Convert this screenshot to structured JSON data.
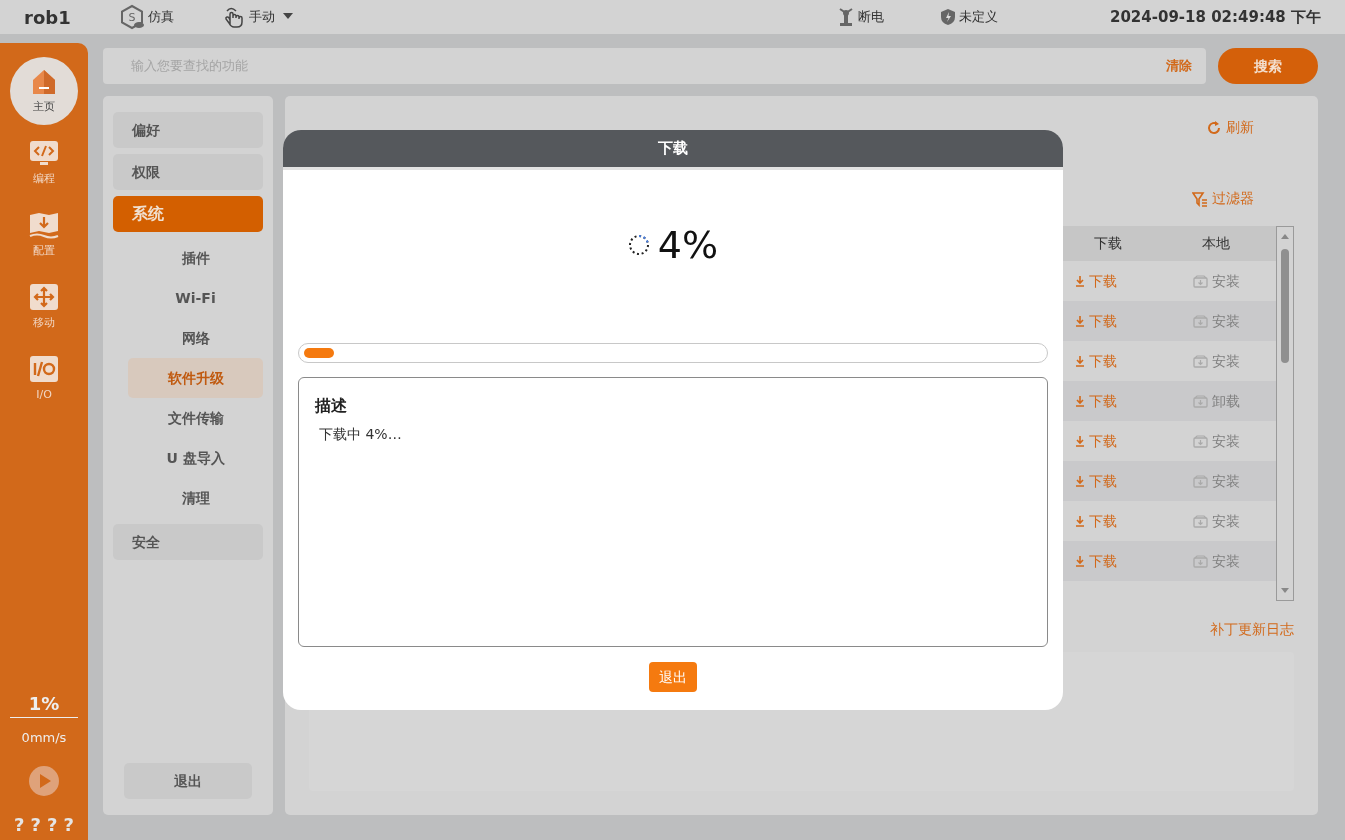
{
  "top_bar": {
    "robot_name": "rob1",
    "mode_badge": "S",
    "mode": "仿真",
    "control": "手动",
    "power": "断电",
    "safety": "未定义",
    "datetime": "2024-09-18 02:49:48 下午"
  },
  "nav_rail": {
    "items": [
      {
        "label": "主页",
        "selected": true
      },
      {
        "label": "编程",
        "selected": false
      },
      {
        "label": "配置",
        "selected": false
      },
      {
        "label": "移动",
        "selected": false
      },
      {
        "label": "I/O",
        "selected": false
      }
    ],
    "speed_percent": "1%",
    "speed": "0mm/s",
    "status_marks": [
      "?",
      "?",
      "?",
      "?"
    ]
  },
  "search": {
    "placeholder": "输入您要查找的功能",
    "clear": "清除",
    "button": "搜索"
  },
  "settings_menu": {
    "items": [
      {
        "label": "偏好",
        "selected": false
      },
      {
        "label": "权限",
        "selected": false
      },
      {
        "label": "系统",
        "selected": true,
        "children": [
          {
            "label": "插件",
            "selected": false
          },
          {
            "label": "Wi-Fi",
            "selected": false
          },
          {
            "label": "网络",
            "selected": false
          },
          {
            "label": "软件升级",
            "selected": true
          },
          {
            "label": "文件传输",
            "selected": false
          },
          {
            "label": "U 盘导入",
            "selected": false
          },
          {
            "label": "清理",
            "selected": false
          }
        ]
      },
      {
        "label": "安全",
        "selected": false
      }
    ],
    "exit": "退出"
  },
  "content": {
    "refresh": "刷新",
    "filter": "过滤器",
    "table": {
      "columns": [
        "下载",
        "本地"
      ],
      "rows": [
        {
          "download": "下载",
          "local_action": "安装"
        },
        {
          "download": "下载",
          "local_action": "安装"
        },
        {
          "download": "下载",
          "local_action": "安装"
        },
        {
          "download": "下载",
          "local_action": "卸载"
        },
        {
          "download": "下载",
          "local_action": "安装"
        },
        {
          "download": "下载",
          "local_action": "安装"
        },
        {
          "download": "下载",
          "local_action": "安装"
        },
        {
          "download": "下载",
          "local_action": "安装"
        }
      ]
    },
    "patch_log": "补丁更新日志"
  },
  "dialog": {
    "title": "下载",
    "progress_text": "4%",
    "level": 0.04,
    "description_title": "描述",
    "description": "下载中 4%…",
    "exit": "退出"
  }
}
